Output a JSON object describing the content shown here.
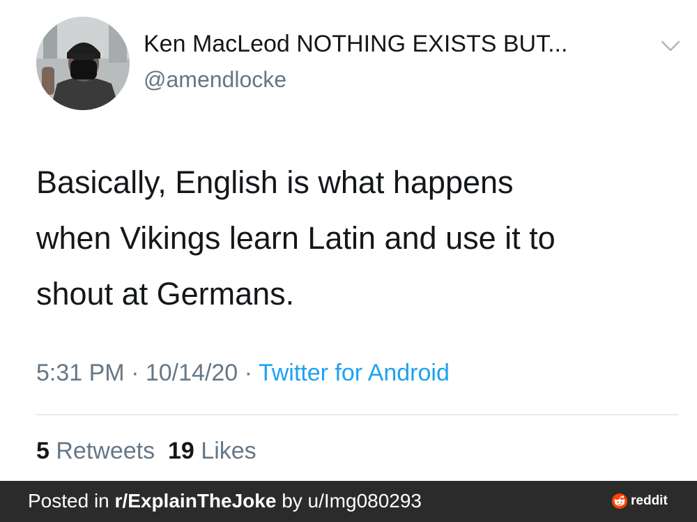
{
  "tweet": {
    "display_name": "Ken MacLeod NOTHING EXISTS BUT...",
    "handle": "@amendlocke",
    "text_lines": [
      "Basically, English is what happens",
      "when Vikings learn Latin and use it to",
      "shout at Germans."
    ],
    "time": "5:31 PM",
    "date": "10/14/20",
    "separator": "·",
    "source": "Twitter for Android",
    "retweets_count": "5",
    "retweets_label": "Retweets",
    "likes_count": "19",
    "likes_label": "Likes"
  },
  "footer": {
    "posted_in": "Posted in",
    "subreddit": "r/ExplainTheJoke",
    "by": "by",
    "user": "u/Img080293",
    "reddit_label": "reddit"
  },
  "colors": {
    "link": "#1da1f2",
    "secondary_text": "#657786",
    "primary_text": "#14171a",
    "footer_bg": "#2b2b2b",
    "reddit_orange": "#ff4500"
  },
  "icons": [
    "chevron-down-icon",
    "reddit-logo-icon"
  ]
}
